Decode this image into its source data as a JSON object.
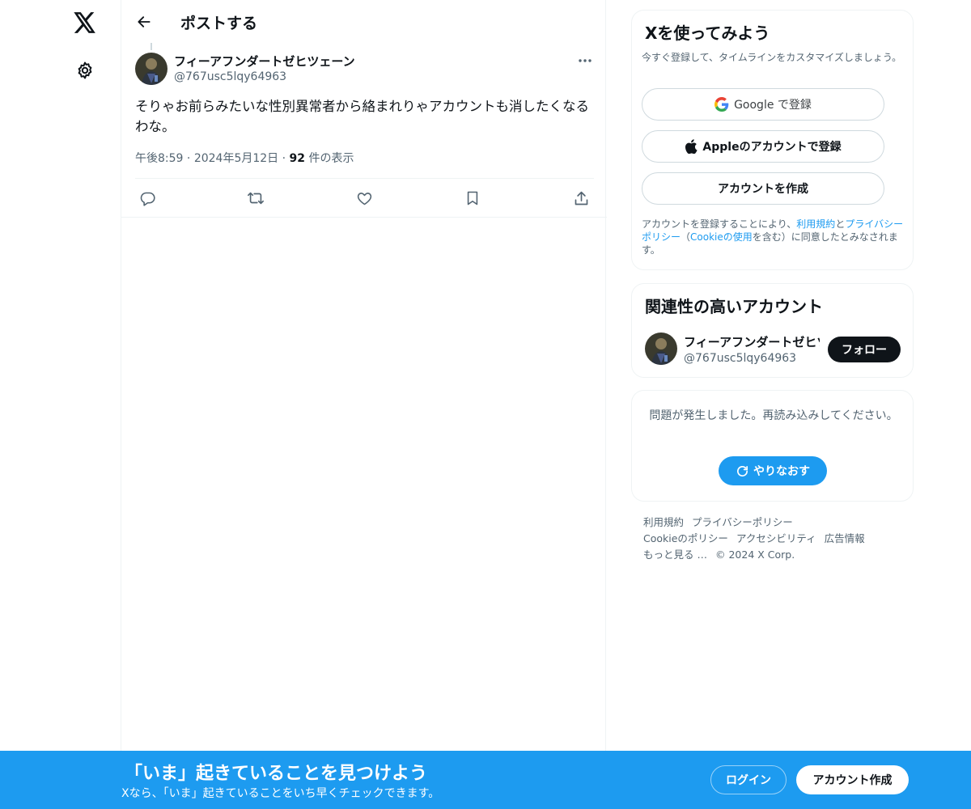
{
  "nav": {
    "logo_icon": "x-logo-icon",
    "settings_icon": "gear-icon"
  },
  "header": {
    "back_icon": "arrow-left-icon",
    "title": "ポストする"
  },
  "post": {
    "author_name": "フィーアフンダートゼヒツェーン",
    "author_handle": "@767usc5lqy64963",
    "text": "そりゃお前らみたいな性別異常者から絡まれりゃアカウントも消したくなるわな。",
    "time": "午後8:59",
    "date": "2024年5月12日",
    "views_count": "92",
    "views_label": "件の表示",
    "actions": [
      "reply-icon",
      "repost-icon",
      "like-icon",
      "bookmark-icon",
      "share-icon"
    ]
  },
  "signup_card": {
    "title": "Xを使ってみよう",
    "subtitle": "今すぐ登録して、タイムラインをカスタマイズしましょう。",
    "google_label": "Google で登録",
    "apple_label": "Appleのアカウントで登録",
    "create_label": "アカウントを作成",
    "terms_prefix": "アカウントを登録することにより、",
    "terms_link": "利用規約",
    "terms_and": "と",
    "privacy_link": "プライバシーポリシー",
    "terms_paren_open": "（",
    "cookie_link": "Cookieの使用",
    "terms_suffix": "を含む）に同意したとみなされます。"
  },
  "related_card": {
    "title": "関連性の高いアカウント",
    "account_name": "フィーアフンダートゼヒツェーン",
    "account_handle": "@767usc5lqy64963",
    "follow_label": "フォロー"
  },
  "error_card": {
    "message": "問題が発生しました。再読み込みしてください。",
    "retry_label": "やりなおす"
  },
  "footer": {
    "links": [
      "利用規約",
      "プライバシーポリシー",
      "Cookieのポリシー",
      "アクセシビリティ",
      "広告情報",
      "もっと見る …"
    ],
    "copyright": "© 2024 X Corp."
  },
  "banner": {
    "title": "「いま」起きていることを見つけよう",
    "subtitle": "Xなら、「いま」起きていることをいち早くチェックできます。",
    "login_label": "ログイン",
    "signup_label": "アカウント作成"
  },
  "colors": {
    "accent": "#1d9bf0",
    "text": "#0f1419",
    "secondary": "#536471",
    "border": "#eff3f4"
  }
}
